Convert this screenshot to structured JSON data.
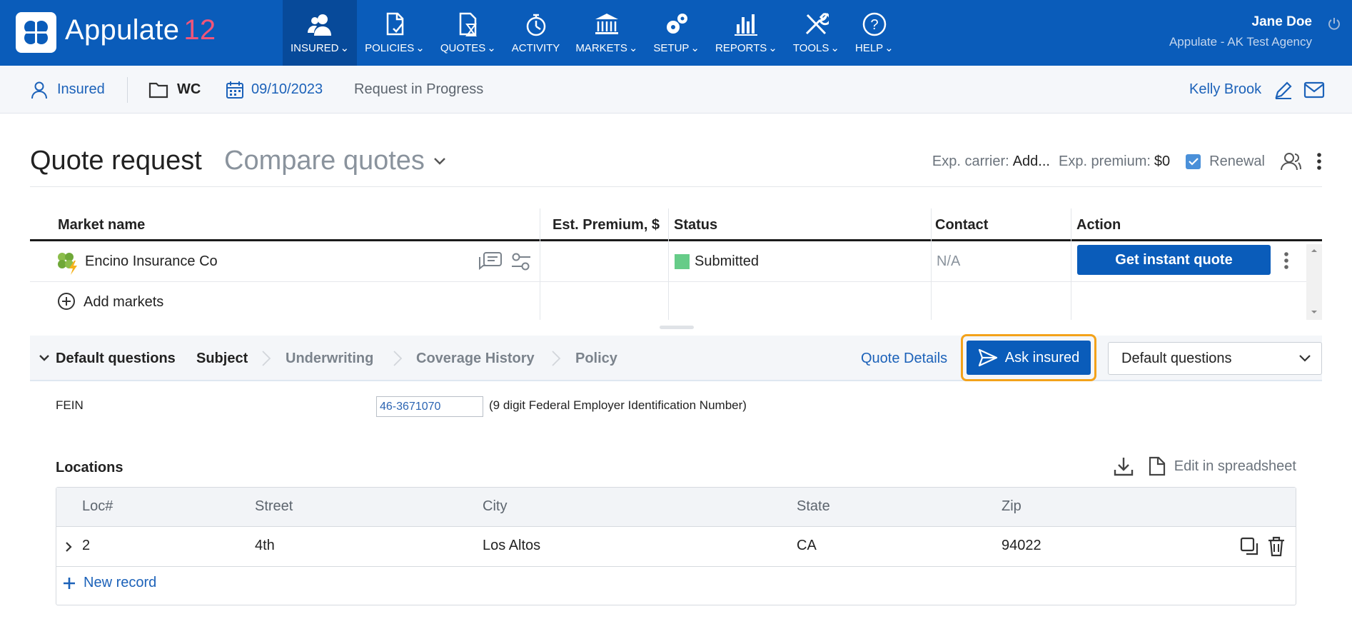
{
  "app": {
    "brand": "Appulate",
    "version": "12"
  },
  "nav": {
    "items": [
      {
        "label": "INSURED",
        "icon": "insured-icon"
      },
      {
        "label": "POLICIES",
        "icon": "policies-icon"
      },
      {
        "label": "QUOTES",
        "icon": "quotes-icon"
      },
      {
        "label": "ACTIVITY",
        "icon": "activity-icon"
      },
      {
        "label": "MARKETS",
        "icon": "markets-icon"
      },
      {
        "label": "SETUP",
        "icon": "setup-icon"
      },
      {
        "label": "REPORTS",
        "icon": "reports-icon"
      },
      {
        "label": "TOOLS",
        "icon": "tools-icon"
      },
      {
        "label": "HELP",
        "icon": "help-icon"
      }
    ]
  },
  "user": {
    "name": "Jane Doe",
    "agency": "Appulate - AK Test Agency"
  },
  "context": {
    "insured": "Insured",
    "lob": "WC",
    "date": "09/10/2023",
    "status": "Request in Progress",
    "assignee": "Kelly Brook"
  },
  "header": {
    "title": "Quote request",
    "compare": "Compare quotes",
    "exp_carrier_label": "Exp. carrier:",
    "exp_carrier_value": "Add...",
    "exp_premium_label": "Exp. premium:",
    "exp_premium_value": "$0",
    "renewal_label": "Renewal"
  },
  "markets": {
    "columns": [
      "Market name",
      "Est. Premium, $",
      "Status",
      "Contact",
      "Action"
    ],
    "rows": [
      {
        "name": "Encino Insurance Co",
        "premium": "",
        "status": "Submitted",
        "status_color": "#66cc88",
        "contact": "N/A",
        "action": "Get instant quote"
      }
    ],
    "add_label": "Add markets"
  },
  "questions": {
    "group": "Default questions",
    "steps": [
      "Subject",
      "Underwriting",
      "Coverage History",
      "Policy"
    ],
    "quote_details": "Quote Details",
    "ask_insured": "Ask insured",
    "select_value": "Default questions"
  },
  "form": {
    "fein_label": "FEIN",
    "fein_value": "46-3671070",
    "fein_hint": "(9 digit Federal Employer Identification Number)"
  },
  "locations": {
    "title": "Locations",
    "edit_label": "Edit in spreadsheet",
    "columns": [
      "Loc#",
      "Street",
      "City",
      "State",
      "Zip"
    ],
    "rows": [
      {
        "loc": "2",
        "street": "4th",
        "city": "Los Altos",
        "state": "CA",
        "zip": "94022"
      }
    ],
    "new_record": "New record"
  },
  "colors": {
    "primary": "#0a5cba",
    "accent": "#f3a21a",
    "version": "#f0557a"
  }
}
